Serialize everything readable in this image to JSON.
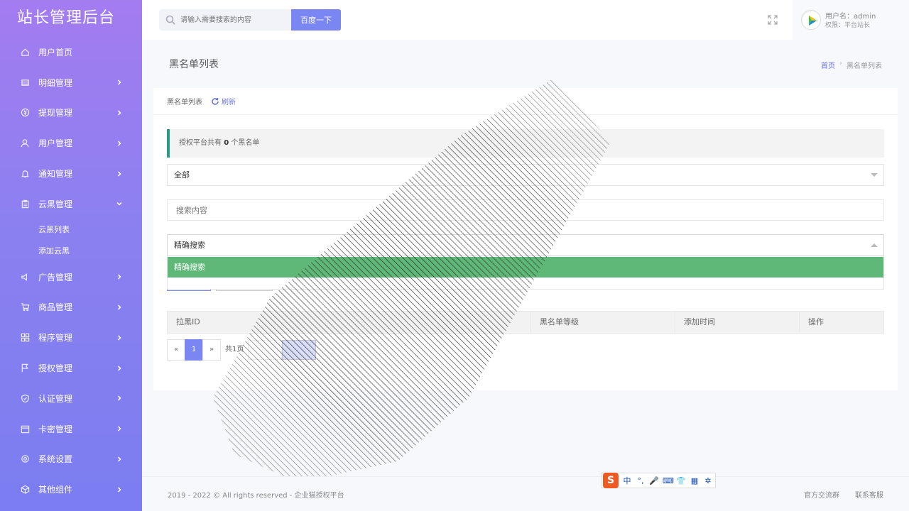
{
  "sidebar": {
    "logo": "站长管理后台",
    "items": [
      {
        "label": "用户首页",
        "icon": "home-icon",
        "arrow": false
      },
      {
        "label": "明细管理",
        "icon": "list-icon",
        "arrow": true
      },
      {
        "label": "提现管理",
        "icon": "yen-icon",
        "arrow": true
      },
      {
        "label": "用户管理",
        "icon": "user-icon",
        "arrow": true
      },
      {
        "label": "通知管理",
        "icon": "bell-icon",
        "arrow": true
      },
      {
        "label": "云黑管理",
        "icon": "clipboard-icon",
        "arrow": true,
        "expanded": true
      },
      {
        "label": "广告管理",
        "icon": "speaker-icon",
        "arrow": true
      },
      {
        "label": "商品管理",
        "icon": "cart-icon",
        "arrow": true
      },
      {
        "label": "程序管理",
        "icon": "apps-icon",
        "arrow": true
      },
      {
        "label": "授权管理",
        "icon": "flag-icon",
        "arrow": true
      },
      {
        "label": "认证管理",
        "icon": "shield-icon",
        "arrow": true
      },
      {
        "label": "卡密管理",
        "icon": "calendar-icon",
        "arrow": true
      },
      {
        "label": "系统设置",
        "icon": "gear-icon",
        "arrow": true
      },
      {
        "label": "其他组件",
        "icon": "box-icon",
        "arrow": true
      }
    ],
    "subitems": [
      "云黑列表",
      "添加云黑"
    ]
  },
  "header": {
    "search_placeholder": "请输入需要搜索的内容",
    "search_button": "百度一下",
    "user_name": "用户名：admin",
    "user_role": "权限：平台站长"
  },
  "page": {
    "title": "黑名单列表",
    "breadcrumb_home": "首页",
    "breadcrumb_sep": "›",
    "breadcrumb_current": "黑名单列表"
  },
  "card": {
    "head_title": "黑名单列表",
    "refresh_label": "刷新",
    "alert_prefix": "授权平台共有",
    "alert_count": "0",
    "alert_suffix": "个黑名单",
    "filter_select_value": "全部",
    "search_placeholder": "搜索内容",
    "mode_select_value": "精确搜索",
    "dropdown_option": "精确搜索",
    "table_headers": [
      "拉黑ID",
      "黑名单等级",
      "添加时间",
      "操作"
    ],
    "pager_prev": "«",
    "pager_current": "1",
    "pager_next": "»",
    "pager_total": "共1页"
  },
  "footer": {
    "copyright": "2019 - 2022 © All rights reserved - ",
    "brand": "企业猫授权平台",
    "link1": "官方交流群",
    "link2": "联系客服"
  },
  "ime": {
    "logo": "S",
    "lang": "中",
    "punct": "°,",
    "mic": "🎤",
    "keyboard": "⌨",
    "skin": "👕",
    "apps": "▦",
    "settings": "✲"
  }
}
